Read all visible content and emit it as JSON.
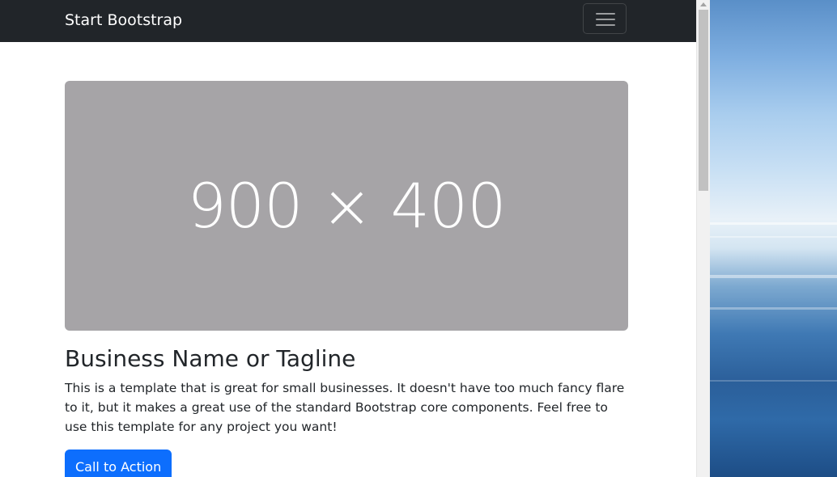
{
  "navbar": {
    "brand": "Start Bootstrap",
    "toggler_icon": "hamburger-menu-icon"
  },
  "hero_image": {
    "placeholder_text": "900 × 400",
    "color": "#a6a4a7"
  },
  "content": {
    "headline": "Business Name or Tagline",
    "lead": "This is a template that is great for small businesses. It doesn't have too much fancy flare to it, but it makes a great use of the standard Bootstrap core components. Feel free to use this template for any project you want!",
    "cta_label": "Call to Action"
  },
  "colors": {
    "navbar_bg": "#212529",
    "primary": "#0d6efd",
    "text": "#212529"
  }
}
